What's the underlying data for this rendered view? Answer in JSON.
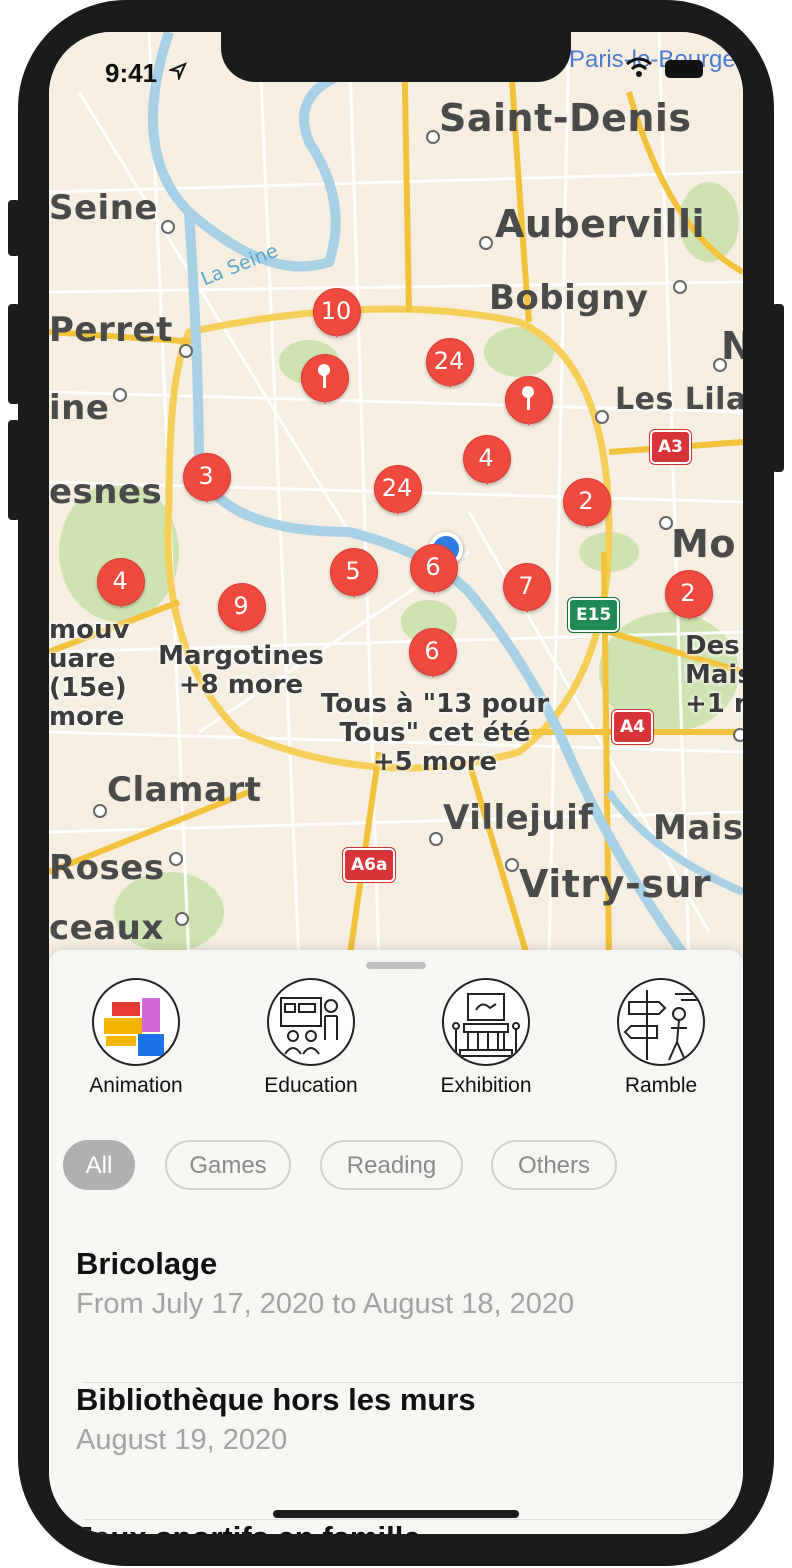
{
  "status_bar": {
    "time": "9:41"
  },
  "map": {
    "top_cutoff_text": "Paris-le-Bourget",
    "places": [
      "Saint-Denis",
      "Seine",
      "Aubervilli",
      "Perret",
      "Bobigny",
      "ine",
      "Les Lila",
      "esnes",
      "Mo",
      "Clamart",
      "Villejuif",
      "Mais",
      "Roses",
      "Vitry-sur",
      "ceaux",
      "N"
    ],
    "river_label": "La Seine",
    "highway_shields": [
      "A3",
      "E15",
      "A4",
      "A6a"
    ],
    "pins": [
      "10",
      "",
      "24",
      "",
      "4",
      "3",
      "24",
      "2",
      "4",
      "9",
      "5",
      "6",
      "7",
      "2",
      "6"
    ],
    "cluster_labels": {
      "left": {
        "l1": "mouv",
        "l2": "uare",
        "l3": "(15e)",
        "more": "more"
      },
      "margotines": {
        "title": "Margotines",
        "more": "+8 more"
      },
      "tous": {
        "l1": "Tous à  \"13 pour",
        "l2": "Tous\" cet été",
        "more": "+5 more"
      },
      "right": {
        "l1": "Des",
        "l2": "Mais",
        "more": "+1 m"
      }
    }
  },
  "categories": [
    {
      "label": "Animation",
      "icon": "lego-blocks-icon"
    },
    {
      "label": "Education",
      "icon": "classroom-icon"
    },
    {
      "label": "Exhibition",
      "icon": "museum-icon"
    },
    {
      "label": "Ramble",
      "icon": "signpost-walker-icon"
    }
  ],
  "filters": [
    "All",
    "Games",
    "Reading",
    "Others"
  ],
  "active_filter": "All",
  "events": [
    {
      "title": "Bricolage",
      "date": "From July 17, 2020 to August 18, 2020"
    },
    {
      "title": "Bibliothèque hors les murs",
      "date": "August 19, 2020"
    },
    {
      "title": "Jeux sportifs en famille"
    }
  ],
  "colors": {
    "pin": "#f0493e",
    "user_location": "#2f7de1",
    "chip_active": "#b0b0b0"
  }
}
